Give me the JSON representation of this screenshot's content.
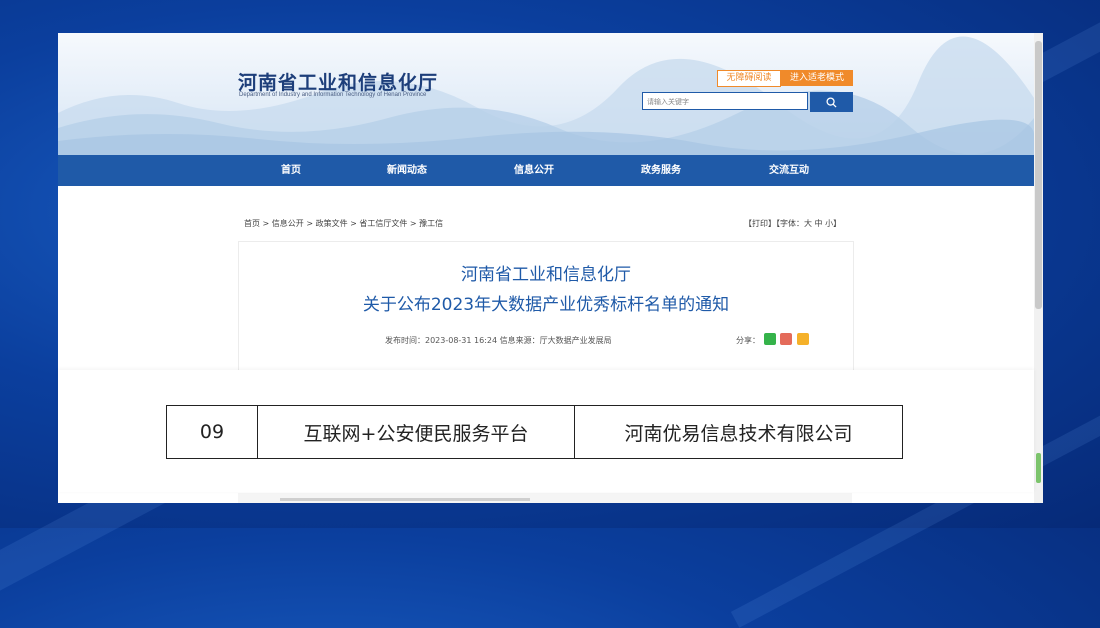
{
  "site": {
    "title": "河南省工业和信息化厅",
    "subtitle": "Department of Industry and Information Technology of Henan Province",
    "accessibility_button": "无障碍阅读",
    "elder_mode_button": "进入适老模式",
    "search_placeholder": "请输入关键字"
  },
  "nav": {
    "items": [
      "首页",
      "新闻动态",
      "信息公开",
      "政务服务",
      "交流互动"
    ]
  },
  "breadcrumb": "首页 > 信息公开 > 政策文件 > 省工信厅文件 > 豫工信",
  "tools": "【打印】【字体：大 中 小】",
  "article": {
    "title_line1": "河南省工业和信息化厅",
    "title_line2": "关于公布2023年大数据产业优秀标杆名单的通知",
    "meta": "发布时间：2023-08-31 16:24   信息来源：厅大数据产业发展局",
    "share_label": "分享："
  },
  "highlight_row": {
    "number": "09",
    "project": "互联网+公安便民服务平台",
    "company": "河南优易信息技术有限公司"
  },
  "colors": {
    "brand_blue": "#1f5aa8",
    "accent_orange": "#f08a2a",
    "background_blue": "#0b3f9e"
  }
}
